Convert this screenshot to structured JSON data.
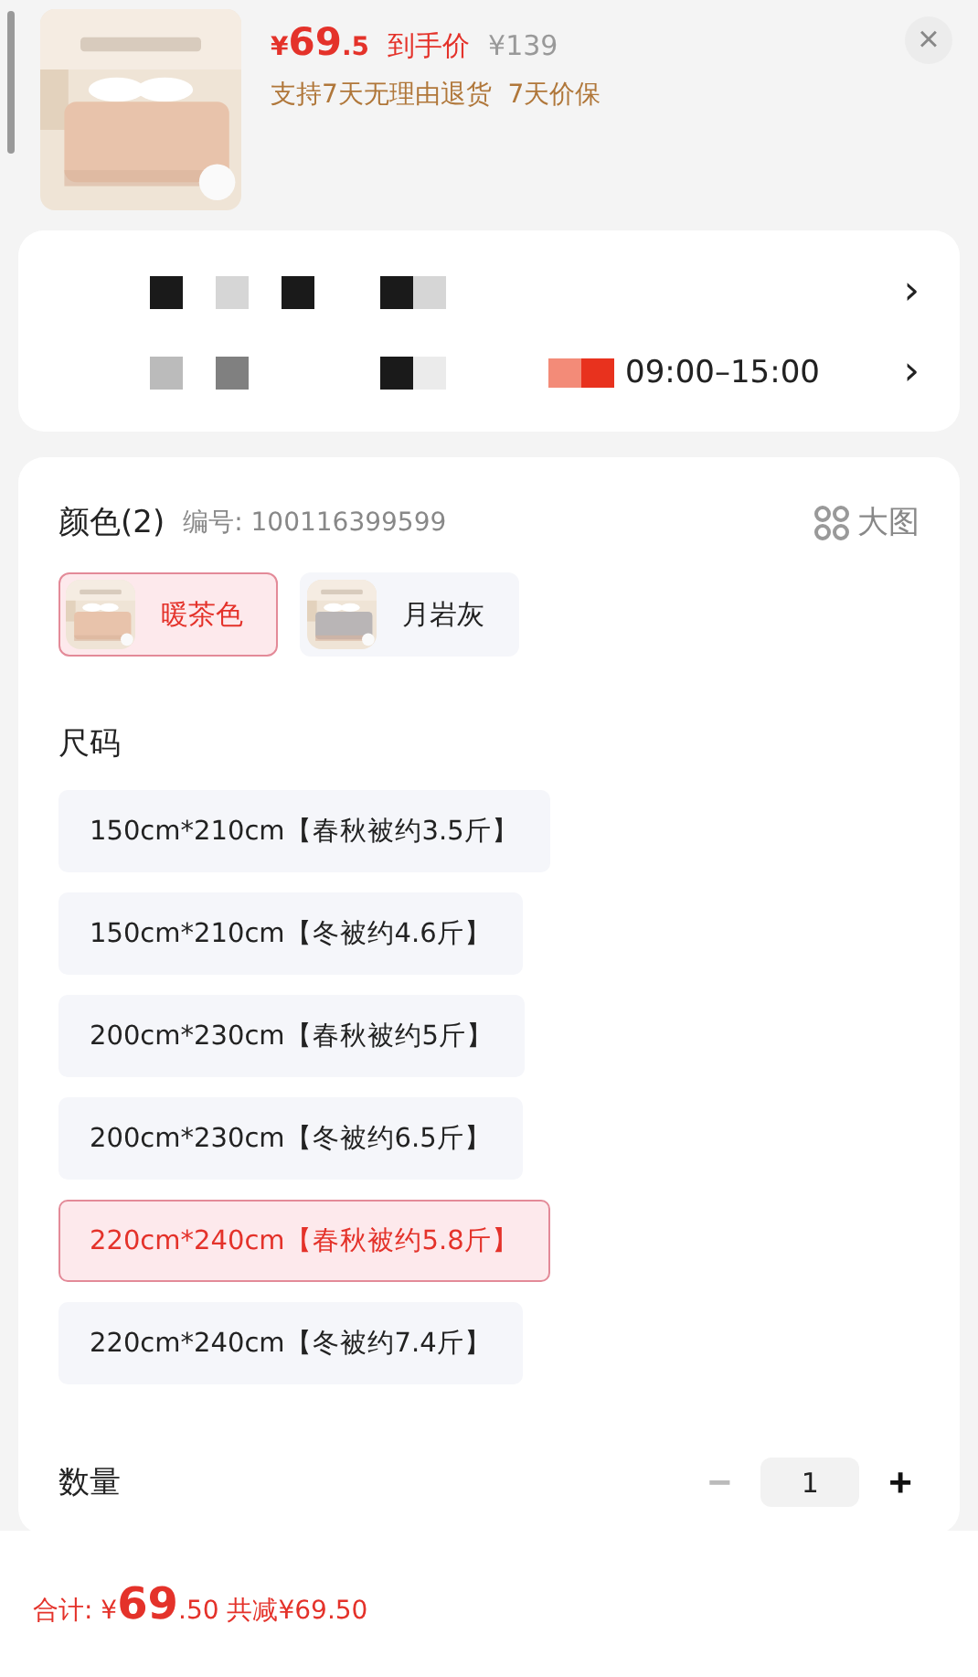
{
  "product": {
    "price": {
      "symbol": "¥",
      "integer": "69",
      "decimal": ".5"
    },
    "price_label": "到手价",
    "original_price": "¥139",
    "promise": "支持7天无理由退货  7天价保",
    "close": "×"
  },
  "delivery": {
    "time": "09:00–15:00",
    "chevrons": [
      "›",
      "›"
    ]
  },
  "color_section": {
    "title": "颜色(2)",
    "code": "编号: 100116399599",
    "big_image": "大图",
    "options": [
      {
        "label": "暖茶色",
        "selected": true
      },
      {
        "label": "月岩灰",
        "selected": false
      }
    ]
  },
  "size_section": {
    "title": "尺码",
    "options": [
      {
        "label": "150cm*210cm【春秋被约3.5斤】",
        "selected": false
      },
      {
        "label": "150cm*210cm【冬被约4.6斤】",
        "selected": false
      },
      {
        "label": "200cm*230cm【春秋被约5斤】",
        "selected": false
      },
      {
        "label": "200cm*230cm【冬被约6.5斤】",
        "selected": false
      },
      {
        "label": "220cm*240cm【春秋被约5.8斤】",
        "selected": true
      },
      {
        "label": "220cm*240cm【冬被约7.4斤】",
        "selected": false
      }
    ]
  },
  "quantity": {
    "label": "数量",
    "minus": "−",
    "value": "1",
    "plus": "+",
    "minus_disabled": true
  },
  "footer": {
    "total_label": "合计:",
    "symbol": "¥",
    "integer": "69",
    "decimal": ".50",
    "discount": "共减¥69.50"
  }
}
